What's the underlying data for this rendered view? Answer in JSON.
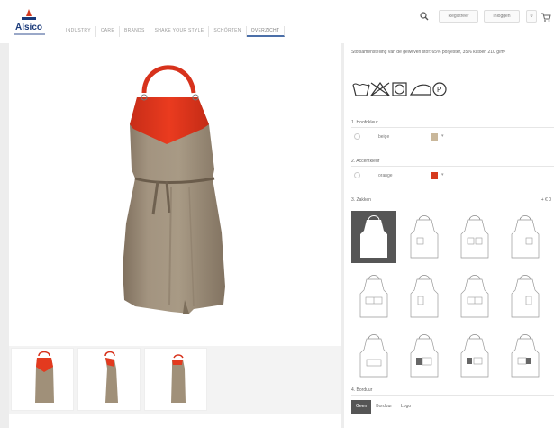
{
  "brand": {
    "name": "Alsico"
  },
  "nav": {
    "items": [
      "INDUSTRY",
      "CARE",
      "BRANDS",
      "SHAKE YOUR STYLE",
      "SCHÖRTEN",
      "OVERZICHT"
    ],
    "active_index": 5
  },
  "header": {
    "search_icon": "search-icon",
    "register_label": "Registreer",
    "login_label": "Inloggen",
    "cart_count": "0"
  },
  "product": {
    "description": "Stofsamenstelling van de geweven stof: 65% polyester, 35% katoen 210 g/m²",
    "care_icons": [
      "wash-40-icon",
      "no-bleach-icon",
      "tumble-dry-icon",
      "iron-icon",
      "dry-clean-p-icon"
    ]
  },
  "sections": {
    "main_color": {
      "title": "1. Hoofdkleur",
      "option": "beige",
      "swatch": "#c9b79a"
    },
    "accent_color": {
      "title": "2. Accentkleur",
      "option": "orange",
      "swatch": "#d63a1e"
    },
    "pockets": {
      "title": "3. Zakken",
      "price": "+ € 0"
    },
    "embroidery": {
      "title": "4. Borduur"
    }
  },
  "tabs": [
    "Geen",
    "Borduur",
    "Logo"
  ],
  "active_tab": 0,
  "colors": {
    "apron": "#9e8e78",
    "accent": "#e8331b",
    "nav_active": "#4b6fa8"
  }
}
